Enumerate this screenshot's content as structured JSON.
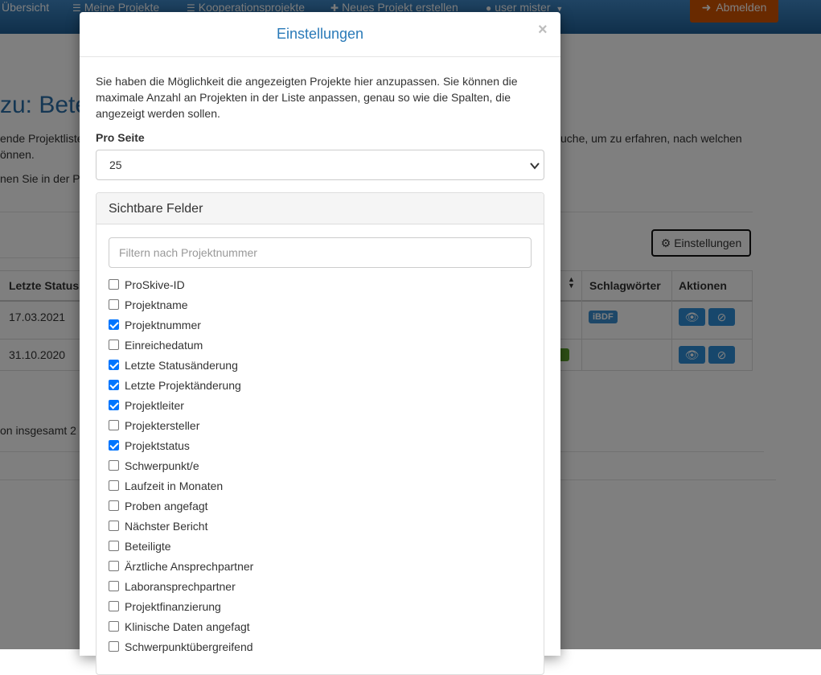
{
  "navbar": {
    "items": [
      {
        "label": "Übersicht",
        "icon": ""
      },
      {
        "label": "Meine Projekte",
        "icon": "list-icon"
      },
      {
        "label": "Kooperationsprojekte",
        "icon": "list-icon"
      },
      {
        "label": "Neues Projekt erstellen",
        "icon": "plus-icon"
      },
      {
        "label": "user mister",
        "icon": "user-icon"
      }
    ],
    "logout_label": "Abmelden",
    "logout_color": "#d35400",
    "bar_color": "#2c6faa"
  },
  "background_page": {
    "title": "zu: Bete",
    "text_lines": [
      "ende Projektliste",
      "önnen.",
      "nen Sie in der Pr",
      "uche, um zu erfahren, nach welchen"
    ],
    "settings_button_label": "Einstellungen",
    "table": {
      "headers": [
        "Letzte Status",
        "Schlagwörter",
        "Aktionen"
      ],
      "rows": [
        {
          "date": "17.03.2021",
          "tag": "iBDF"
        },
        {
          "date": "31.10.2020",
          "tag": ""
        }
      ]
    },
    "footer_text": "on insgesamt 2"
  },
  "modal": {
    "title": "Einstellungen",
    "close_symbol": "×",
    "intro": "Sie haben die Möglichkeit die angezeigten Projekte hier anzupassen. Sie können die maximale Anzahl an Projekten in der Liste anpassen, genau so wie die Spalten, die angezeigt werden sollen.",
    "per_page_label": "Pro Seite",
    "per_page_value": "25",
    "fields_panel_title": "Sichtbare Felder",
    "filter_placeholder": "Filtern nach Projektnummer",
    "fields": [
      {
        "label": "ProSkive-ID",
        "checked": false
      },
      {
        "label": "Projektname",
        "checked": false
      },
      {
        "label": "Projektnummer",
        "checked": true
      },
      {
        "label": "Einreichedatum",
        "checked": false
      },
      {
        "label": "Letzte Statusänderung",
        "checked": true
      },
      {
        "label": "Letzte Projektänderung",
        "checked": true
      },
      {
        "label": "Projektleiter",
        "checked": true
      },
      {
        "label": "Projektersteller",
        "checked": false
      },
      {
        "label": "Projektstatus",
        "checked": true
      },
      {
        "label": "Schwerpunkt/e",
        "checked": false
      },
      {
        "label": "Laufzeit in Monaten",
        "checked": false
      },
      {
        "label": "Proben angefagt",
        "checked": false
      },
      {
        "label": "Nächster Bericht",
        "checked": false
      },
      {
        "label": "Beteiligte",
        "checked": false
      },
      {
        "label": "Ärztliche Ansprechpartner",
        "checked": false
      },
      {
        "label": "Laboransprechpartner",
        "checked": false
      },
      {
        "label": "Projektfinanzierung",
        "checked": false
      },
      {
        "label": "Klinische Daten angefagt",
        "checked": false
      },
      {
        "label": "Schwerpunktübergreifend",
        "checked": false
      }
    ]
  }
}
